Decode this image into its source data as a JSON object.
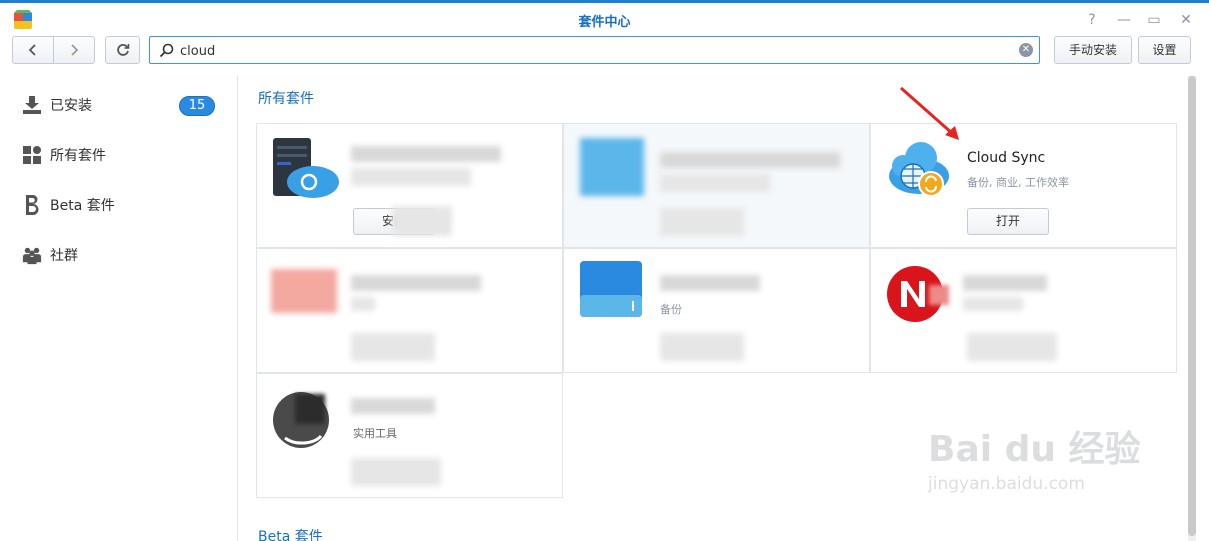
{
  "window": {
    "title": "套件中心",
    "controls": [
      "help-icon",
      "minimize-icon",
      "maximize-icon",
      "close-icon"
    ]
  },
  "toolbar": {
    "search_value": "cloud",
    "manual_install_label": "手动安装",
    "settings_label": "设置"
  },
  "sidebar": {
    "items": [
      {
        "label": "已安装",
        "icon": "download-icon",
        "badge": "15"
      },
      {
        "label": "所有套件",
        "icon": "grid-icon"
      },
      {
        "label": "Beta 套件",
        "icon": "beta-icon"
      },
      {
        "label": "社群",
        "icon": "community-icon"
      }
    ]
  },
  "main": {
    "sections": [
      {
        "title": "所有套件"
      },
      {
        "title": "Beta 套件"
      }
    ],
    "packages": [
      {
        "name": "",
        "category": "",
        "button": "安装",
        "icon": "server-cloud-icon",
        "blurred": true
      },
      {
        "name": "",
        "category": "",
        "button": "",
        "icon": "cloud-icon",
        "blurred": true
      },
      {
        "name": "Cloud Sync",
        "category": "备份, 商业, 工作效率",
        "button": "打开",
        "icon": "cloud-sync-icon",
        "blurred": false
      },
      {
        "name": "",
        "category": "",
        "button": "",
        "icon": "red-package-icon",
        "blurred": true
      },
      {
        "name": "",
        "category": "备份",
        "button": "",
        "icon": "blue-drive-icon",
        "blurred": true
      },
      {
        "name": "",
        "category": "",
        "button": "",
        "icon": "red-n-icon",
        "blurred": true
      },
      {
        "name": "",
        "category": "实用工具",
        "button": "",
        "icon": "dark-package-icon",
        "blurred": true
      }
    ]
  },
  "watermark": {
    "line1": "Bai du 经验",
    "line2": "jingyan.baidu.com"
  },
  "colors": {
    "accent": "#1670c4",
    "badge": "#2a8ae0",
    "annotation_arrow": "#e8241c"
  }
}
